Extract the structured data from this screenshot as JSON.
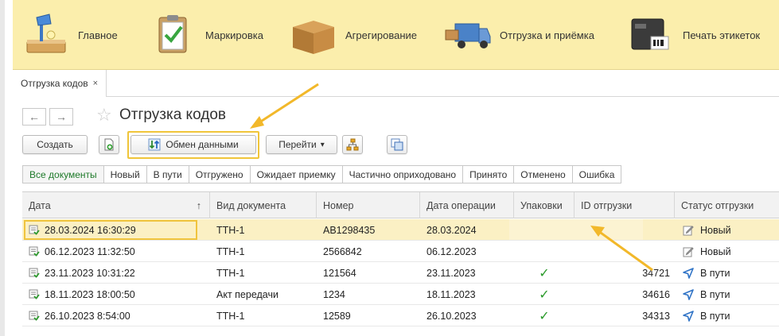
{
  "sections": [
    {
      "label": "Главное",
      "icon": "desk-lamp-icon"
    },
    {
      "label": "Маркировка",
      "icon": "clipboard-check-icon"
    },
    {
      "label": "Агрегирование",
      "icon": "cardboard-box-icon"
    },
    {
      "label": "Отгрузка и приёмка",
      "icon": "delivery-truck-icon"
    },
    {
      "label": "Печать этикеток",
      "icon": "label-printer-icon"
    }
  ],
  "tab": {
    "label": "Отгрузка кодов",
    "close": "×"
  },
  "nav": {
    "back": "←",
    "forward": "→",
    "favorite": "☆"
  },
  "page_title": "Отгрузка кодов",
  "toolbar": {
    "create": "Создать",
    "exchange": "Обмен данными",
    "goto": "Перейти",
    "goto_arrow": "▾"
  },
  "filters": [
    "Все документы",
    "Новый",
    "В пути",
    "Отгружено",
    "Ожидает приемку",
    "Частично оприходовано",
    "Принято",
    "Отменено",
    "Ошибка"
  ],
  "table": {
    "headers": {
      "date": "Дата",
      "sort": "↑",
      "doc_type": "Вид документа",
      "number": "Номер",
      "op_date": "Дата операции",
      "packages": "Упаковки",
      "shipment_id": "ID отгрузки",
      "status": "Статус отгрузки"
    },
    "rows": [
      {
        "date": "28.03.2024 16:30:29",
        "doc_type": "ТТН-1",
        "number": "АВ1298435",
        "op_date": "28.03.2024",
        "packages": "",
        "shipment_id": "",
        "status": "Новый",
        "status_icon": "edit-icon"
      },
      {
        "date": "06.12.2023 11:32:50",
        "doc_type": "ТТН-1",
        "number": "2566842",
        "op_date": "06.12.2023",
        "packages": "",
        "shipment_id": "",
        "status": "Новый",
        "status_icon": "edit-icon"
      },
      {
        "date": "23.11.2023 10:31:22",
        "doc_type": "ТТН-1",
        "number": "121564",
        "op_date": "23.11.2023",
        "packages": "✓",
        "shipment_id": "34721",
        "status": "В пути",
        "status_icon": "send-icon"
      },
      {
        "date": "18.11.2023 18:00:50",
        "doc_type": "Акт передачи",
        "number": "1234",
        "op_date": "18.11.2023",
        "packages": "✓",
        "shipment_id": "34616",
        "status": "В пути",
        "status_icon": "send-icon"
      },
      {
        "date": "26.10.2023 8:54:00",
        "doc_type": "ТТН-1",
        "number": "12589",
        "op_date": "26.10.2023",
        "packages": "✓",
        "shipment_id": "34313",
        "status": "В пути",
        "status_icon": "send-icon"
      }
    ]
  },
  "colors": {
    "section_bar": "#fbeeac",
    "highlight": "#f0c53a",
    "active_filter": "#1e7a2a",
    "selected_row": "#fbf0c4",
    "check": "#2a9a2a",
    "arrow": "#f2b82a"
  }
}
